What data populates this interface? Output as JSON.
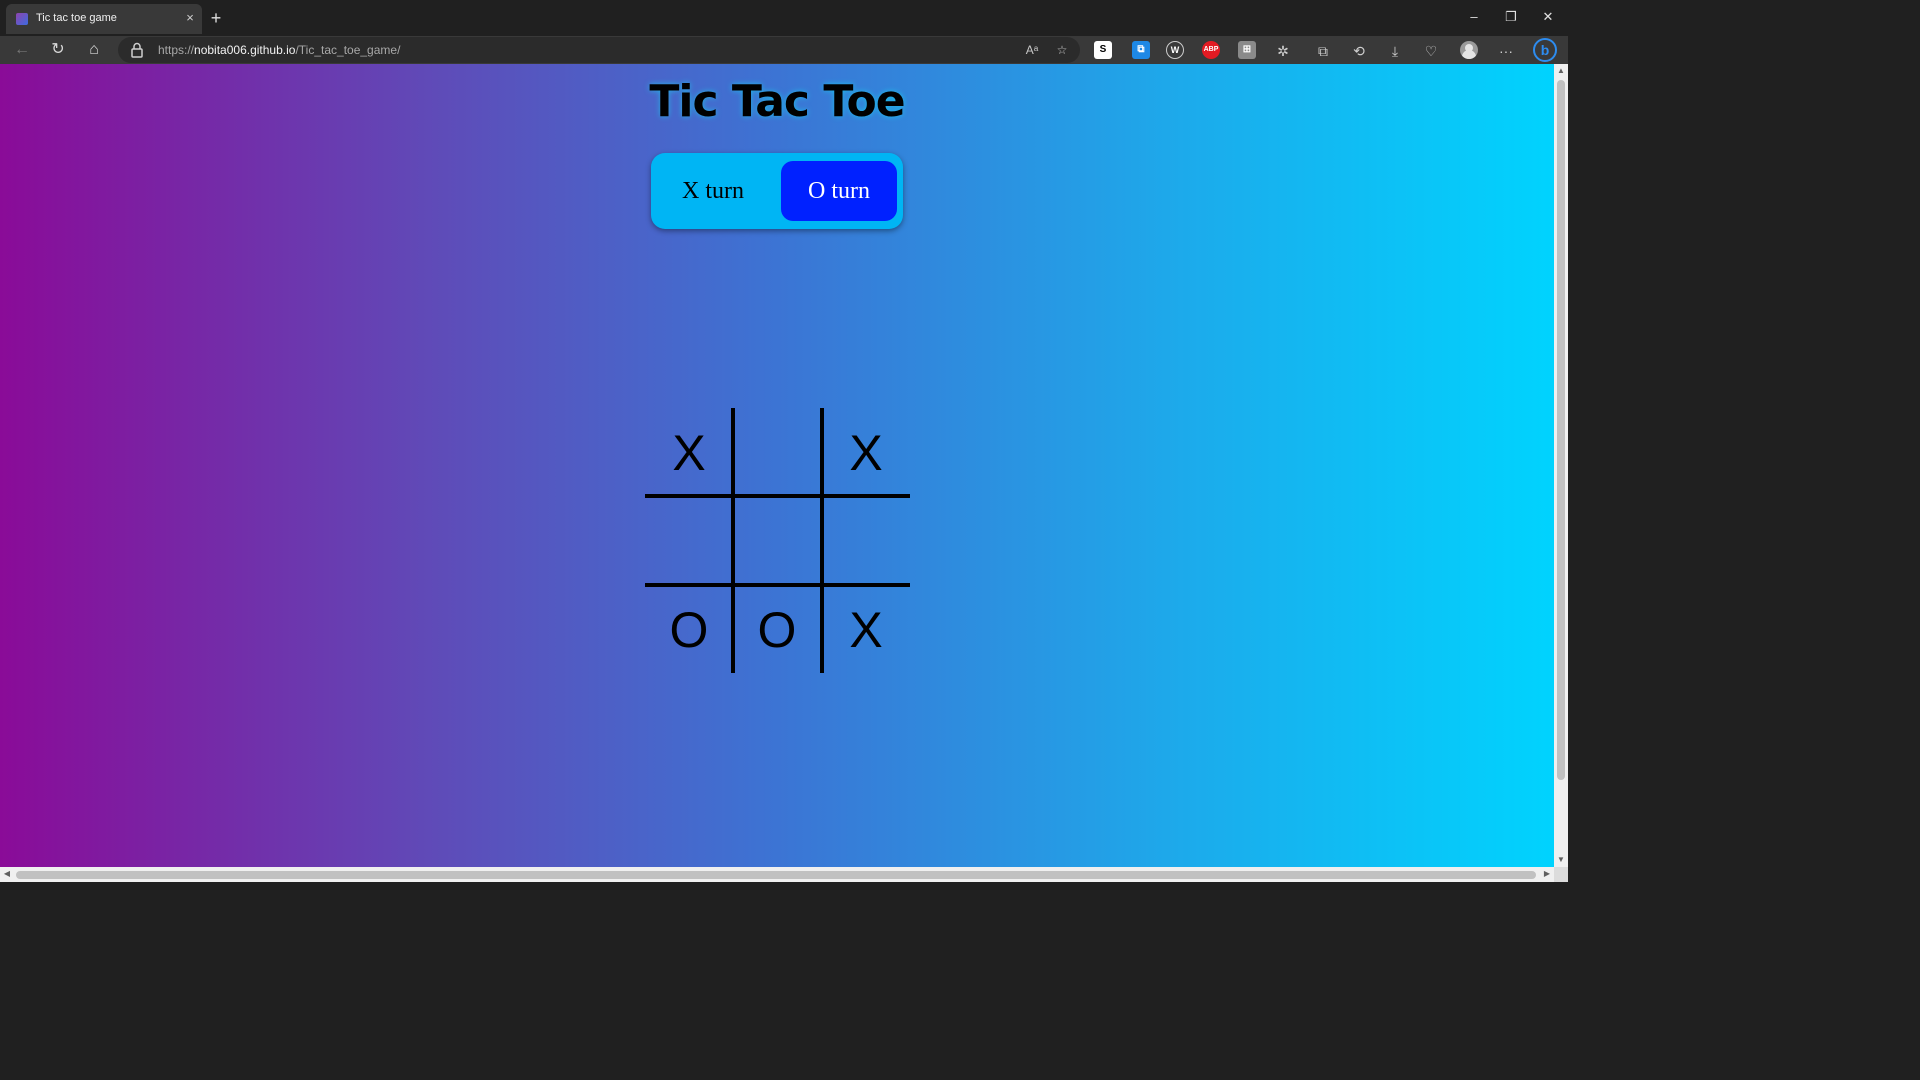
{
  "browser": {
    "tab_title": "Tic tac toe game",
    "tab_close": "×",
    "new_tab": "+",
    "url_scheme": "https://",
    "url_host": "nobita006.github.io",
    "url_path": "/Tic_tac_toe_game/",
    "window": {
      "minimize": "–",
      "restore": "❐",
      "close": "✕"
    },
    "extensions": [
      {
        "name": "s-extension-icon",
        "label": "S",
        "color": "#ffffff",
        "text_color": "#000000"
      },
      {
        "name": "translate-extension-icon",
        "label": "",
        "color": "#1e88e5"
      },
      {
        "name": "w-extension-icon",
        "label": "W",
        "color": "#3a3a3a"
      },
      {
        "name": "adblock-plus-icon",
        "label": "ABP",
        "color": "#e31b23"
      },
      {
        "name": "tab-extension-icon",
        "label": "",
        "color": "#8a8a8a"
      }
    ]
  },
  "game": {
    "title": "Tic Tac Toe",
    "turn_x_label": "X turn",
    "turn_o_label": "O turn",
    "active_turn": "O",
    "active_color": "#0021ff",
    "turn_box_color": "#00b5f4",
    "board": [
      "X",
      "",
      "X",
      "",
      "",
      "",
      "O",
      "O",
      "X"
    ]
  }
}
